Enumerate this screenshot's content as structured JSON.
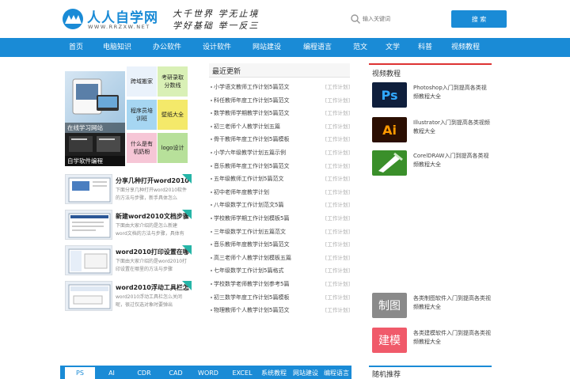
{
  "header": {
    "logo_text": "人人自学网",
    "logo_sub": "WWW.RRZXW.NET",
    "slogan_line1": "大千世界  学无止境",
    "slogan_line2": "学好基础  举一反三",
    "search_placeholder": "输入关键词",
    "search_button": "搜 索",
    "brand_color": "#1a8bd6"
  },
  "nav": {
    "items": [
      "首页",
      "电脑知识",
      "办公软件",
      "设计软件",
      "网站建设",
      "编程语言",
      "范文",
      "文学",
      "科普",
      "视频教程"
    ]
  },
  "tiles": {
    "big1": "在线学习网站",
    "big2": "自学软件编程",
    "small": [
      "跨域搬家",
      "考研录取分数线",
      "程序员培训班",
      "壁纸大全",
      "什么是有机奶粉",
      "logo设计"
    ]
  },
  "articles": [
    {
      "title": "分享几种打开word2010",
      "desc": "下面分享几种打开word2010软件的方法与步骤，新手具体怎么"
    },
    {
      "title": "新建word2010文档步骤",
      "desc": "下面由大家介绍的是怎么新建word文档的方法与步骤，具体有"
    },
    {
      "title": "word2010打印设置在哪",
      "desc": "下面由大家介绍的是word2010打印设置在哪里的方法与步骤"
    },
    {
      "title": "word2010浮动工具栏怎",
      "desc": "word2010浮动工具栏怎么关闭呢，很过仅选对象时要弹出"
    }
  ],
  "updates": {
    "title": "最近更新",
    "tag": "[工作计划]",
    "items": [
      "小学语文教师工作计划5篇范文",
      "科任教师年度工作计划5篇范文",
      "数学教师学期教学计划5篇范文",
      "初三老师个人教学计划五篇",
      "骨干教师年度工作计划5篇模板",
      "小学六年级教学计划五篇示例",
      "音乐教师年度工作计划5篇范文",
      "五年级教师工作计划5篇范文",
      "初中老师年度教学计划",
      "八年级数学工作计划范文5篇",
      "学校教师学期工作计划模板5篇",
      "三年级数学工作计划五篇范文",
      "音乐教师年度教学计划5篇范文",
      "高三老师个人教学计划模板五篇",
      "七年级数学工作计划5篇格式",
      "学校数学老师教学计划参考5篇",
      "初三数学年度工作计划5篇模板",
      "物理教师个人教学计划5篇范文"
    ]
  },
  "video": {
    "title": "视频教程",
    "items": [
      {
        "icon": "Ps",
        "text": "Photoshop入门到提高各类视频教程大全"
      },
      {
        "icon": "Ai",
        "text": "Illustrator入门到提高各类视频教程大全"
      },
      {
        "icon": "CorelDRAW",
        "text": "CorelDRAW入门到提高各类视频教程大全"
      },
      {
        "icon": "制图",
        "text": "各类制图软件入门到提高各类视频教程大全"
      },
      {
        "icon": "建模",
        "text": "各类建模软件入门到提高各类视频教程大全"
      }
    ]
  },
  "bottom_tabs": [
    "PS",
    "AI",
    "CDR",
    "CAD",
    "WORD",
    "EXCEL",
    "系统教程",
    "网站建设",
    "编程语言"
  ],
  "random_title": "随机推荐"
}
